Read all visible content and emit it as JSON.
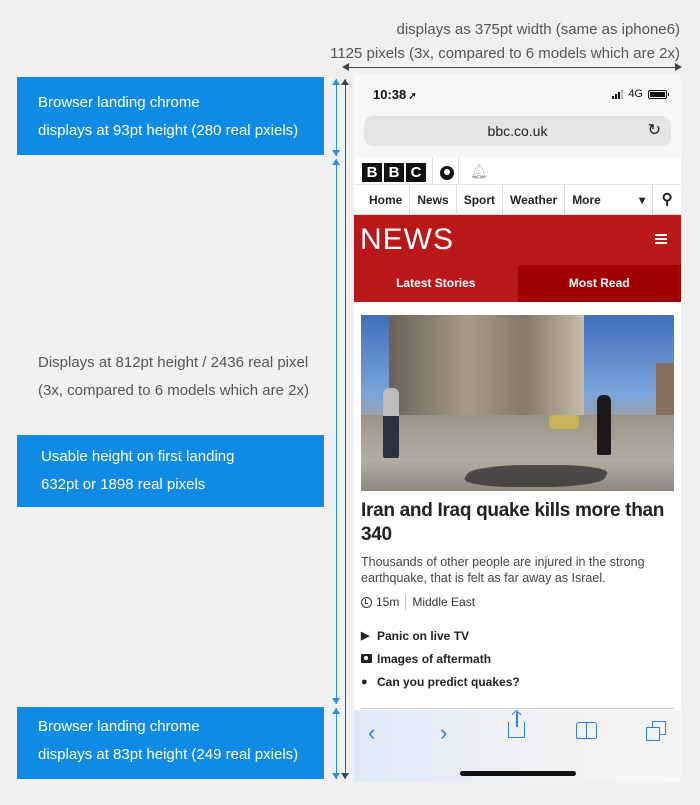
{
  "annotations": {
    "width_note": [
      "displays as 375pt width (same as iphone6)",
      "1125 pixels (3x, compared to 6 models which are 2x)"
    ],
    "top_chrome_note": [
      "Browser landing chrome",
      "displays at 93pt height (280 real pxiels)"
    ],
    "total_height_note": [
      "Displays at 812pt height / 2436 real pixel",
      "(3x, compared to 6 models which are 2x)"
    ],
    "usable_height_note": [
      "Usable height on first landing",
      "632pt or 1898 real pixels"
    ],
    "bottom_chrome_note": [
      "Browser landing chrome",
      "displays at 83pt height (249 real pxiels)"
    ],
    "note_box_color": "#0f8be6"
  },
  "status_bar": {
    "time": "10:38",
    "location_icon": "location-arrow-icon",
    "network": "4G"
  },
  "url_bar": {
    "url": "bbc.co.uk",
    "reload_icon": "reload-icon"
  },
  "bbc": {
    "logo": [
      "B",
      "B",
      "C"
    ],
    "nav": [
      "Home",
      "News",
      "Sport",
      "Weather",
      "More"
    ],
    "more_caret": "▾",
    "search_icon": "search-icon"
  },
  "news": {
    "title": "NEWS",
    "brand_color": "#bb1919",
    "tabs": [
      {
        "label": "Latest Stories",
        "active": false
      },
      {
        "label": "Most Read",
        "active": true
      }
    ]
  },
  "story": {
    "headline": "Iran and Iraq quake kills more than 340",
    "summary": "Thousands of other people are injured in the strong earthquake, that is felt as far away as Israel.",
    "age": "15m",
    "section": "Middle East",
    "related": [
      {
        "icon": "play-icon",
        "label": "Panic on live TV"
      },
      {
        "icon": "camera-icon",
        "label": "Images of aftermath"
      },
      {
        "icon": "bullet-icon",
        "label": "Can you predict quakes?"
      }
    ]
  },
  "toolbar": {
    "back": "‹",
    "forward": "›",
    "accent": "#2f7fe0"
  }
}
